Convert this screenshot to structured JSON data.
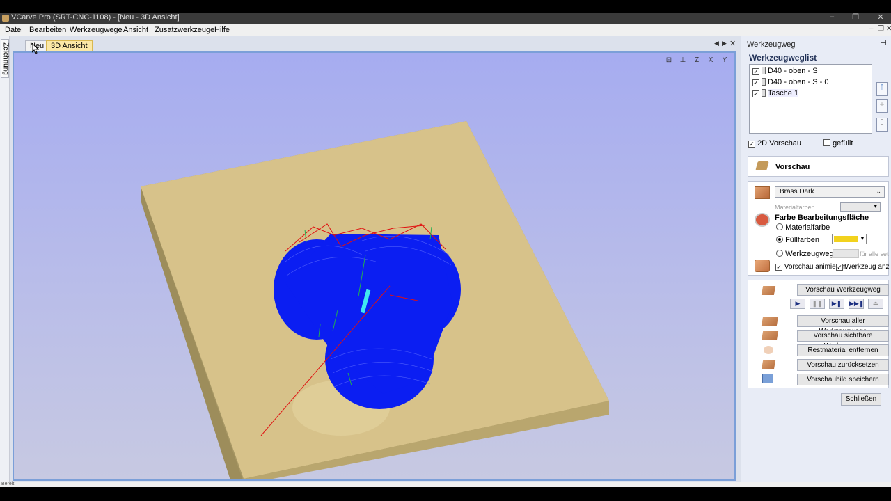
{
  "window": {
    "title": "VCarve Pro (SRT-CNC-1108) - [Neu - 3D Ansicht]",
    "controls": [
      "–",
      "❐",
      "✕"
    ]
  },
  "menu": [
    "Datei",
    "Bearbeiten",
    "Werkzeugwege",
    "Ansicht",
    "Zusatzwerkzeuge",
    "Hilfe"
  ],
  "mdi_controls": [
    "–",
    "❐",
    "✕"
  ],
  "left_tab": "Zeichnung",
  "doc_tabs": [
    {
      "label": "Neu",
      "active": false
    },
    {
      "label": "3D Ansicht",
      "active": true
    }
  ],
  "tab_nav": [
    "◀",
    "▶",
    "✕"
  ],
  "view_toolbar": [
    "⊡",
    "⊥",
    "Z",
    "X",
    "Y"
  ],
  "status": "Bereit",
  "panel": {
    "header": "Werkzeugweg",
    "pin": "⊣",
    "list_title": "Werkzeugweglist",
    "toolpaths": [
      {
        "name": "D40 - oben - S",
        "checked": "✓"
      },
      {
        "name": "D40 - oben - S - 0",
        "checked": "✓"
      },
      {
        "name": "Tasche 1",
        "checked": "✓"
      }
    ],
    "side_buttons": [
      "⇧",
      "+",
      "▯"
    ],
    "preview2d_label": "2D Vorschau",
    "preview2d_check": "✓",
    "filled_label": "gefüllt",
    "preview_title": "Vorschau",
    "material": {
      "selected": "Brass Dark",
      "arrow": "⌄",
      "colors_label": "Materialfarben",
      "colors_arrow": "▾"
    },
    "surface": {
      "title": "Farbe Bearbeitungsfläche",
      "options": [
        "Materialfarbe",
        "Füllfarben",
        "Werkzeugweg Fü"
      ],
      "selected_index": 1,
      "fill_color": "#f2d21e",
      "fill_arrow": "▼",
      "for_all": "für alle setzen"
    },
    "animate": {
      "label": "Vorschau animieren",
      "check": "✓"
    },
    "show_tool": {
      "label": "Werkzeug anzeigen",
      "check": "✓"
    },
    "buttons": {
      "preview_toolpath": "Vorschau Werkzeugweg",
      "preview_all": "Vorschau aller Werkzeugwege",
      "preview_visible": "Vorschau sichtbare Werkzeugw.",
      "remove_rest": "Restmaterial entfernen",
      "reset": "Vorschau zurücksetzen",
      "save_image": "Vorschaubild speichern",
      "close": "Schließen"
    },
    "playback": [
      "▶",
      "❚❚",
      "▶❚",
      "▶▶❚",
      "⏏"
    ]
  },
  "colors": {
    "viewport_top": "#a6acf0",
    "material": "#d7c28a",
    "toolpath_blue": "#0b1ef2",
    "rapid_red": "#e01010",
    "tool_cyan": "#40e8f0"
  }
}
